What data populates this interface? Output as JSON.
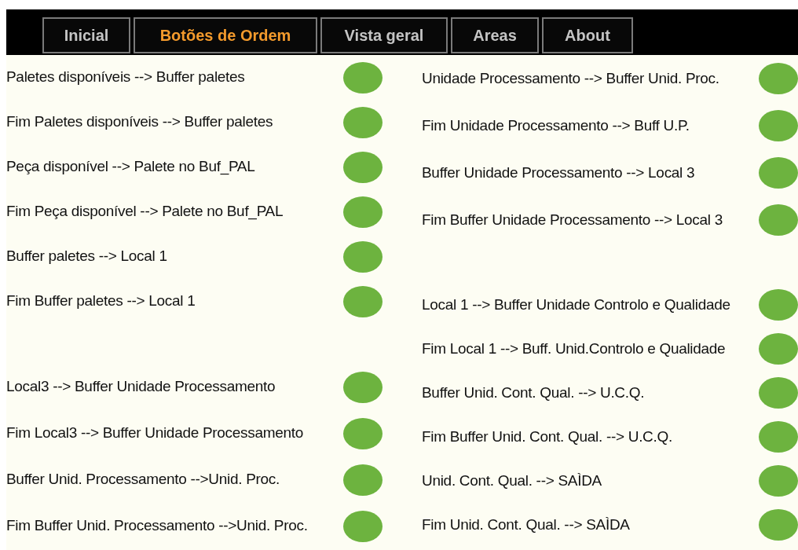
{
  "nav": [
    {
      "label": "Inicial",
      "selected": false
    },
    {
      "label": "Botões de Ordem",
      "selected": true
    },
    {
      "label": "Vista geral",
      "selected": false
    },
    {
      "label": "Areas",
      "selected": false
    },
    {
      "label": "About",
      "selected": false
    }
  ],
  "columns": [
    {
      "groups": [
        [
          "Paletes disponíveis --> Buffer paletes",
          "Fim Paletes disponíveis --> Buffer paletes",
          "Peça disponível --> Palete no Buf_PAL",
          "Fim Peça disponível --> Palete no Buf_PAL",
          "Buffer paletes --> Local 1",
          "Fim Buffer paletes --> Local 1"
        ],
        [
          "Local3 --> Buffer Unidade Processamento",
          "Fim Local3 --> Buffer Unidade Processamento",
          "Buffer Unid. Processamento -->Unid. Proc.",
          "Fim Buffer Unid. Processamento -->Unid. Proc."
        ]
      ]
    },
    {
      "groups": [
        [
          "Unidade Processamento --> Buffer Unid. Proc.",
          "Fim Unidade Processamento --> Buff U.P.",
          "Buffer Unidade Processamento --> Local 3",
          "Fim Buffer Unidade Processamento --> Local 3"
        ],
        [
          "Local 1 --> Buffer Unidade Controlo e Qualidade",
          "Fim Local 1 --> Buff. Unid.Controlo e Qualidade",
          "Buffer Unid. Cont. Qual. --> U.C.Q.",
          "Fim Buffer Unid. Cont. Qual. --> U.C.Q.",
          "Unid. Cont. Qual. --> SAÌDA",
          "Fim Unid. Cont. Qual. --> SAÌDA"
        ]
      ]
    }
  ]
}
